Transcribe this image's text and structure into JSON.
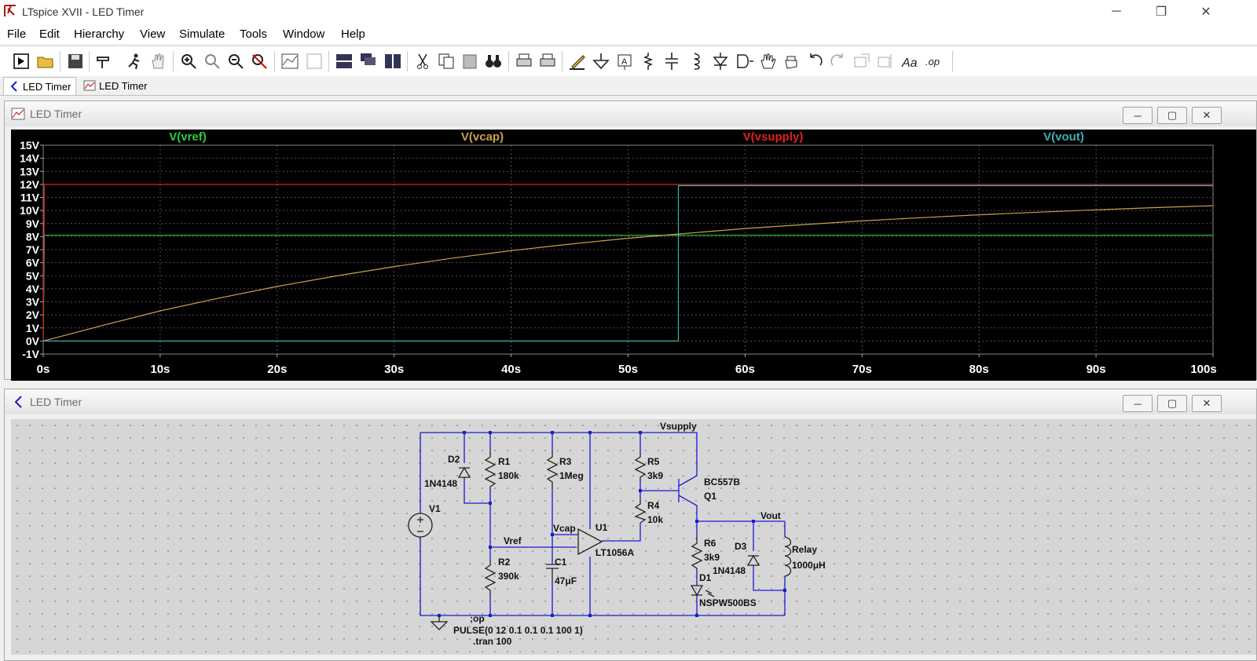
{
  "app": {
    "title": "LTspice XVII - LED Timer"
  },
  "menu": [
    "File",
    "Edit",
    "Hierarchy",
    "View",
    "Simulate",
    "Tools",
    "Window",
    "Help"
  ],
  "tabs": [
    {
      "label": "LED Timer"
    },
    {
      "label": "LED Timer"
    }
  ],
  "plot_window": {
    "title": "LED Timer"
  },
  "schematic_window": {
    "title": "LED Timer"
  },
  "colors": {
    "vref": "#2ecc40",
    "vcap": "#c8a050",
    "vsupply": "#e02020",
    "vout": "#40b0b0",
    "wire": "#1a1ad0",
    "grid": "#666666"
  },
  "chart_data": {
    "type": "line",
    "title": "",
    "xlabel": "",
    "ylabel": "",
    "xlim": [
      0,
      100
    ],
    "ylim": [
      -1,
      15
    ],
    "xticks": [
      "0s",
      "10s",
      "20s",
      "30s",
      "40s",
      "50s",
      "60s",
      "70s",
      "80s",
      "90s",
      "100s"
    ],
    "yticks": [
      "15V",
      "14V",
      "13V",
      "12V",
      "11V",
      "10V",
      "9V",
      "8V",
      "7V",
      "6V",
      "5V",
      "4V",
      "3V",
      "2V",
      "1V",
      "0V",
      "-1V"
    ],
    "grid": true,
    "series": [
      {
        "name": "V(vref)",
        "x": [
          0,
          0.1,
          100
        ],
        "values": [
          0,
          8.1,
          8.1
        ]
      },
      {
        "name": "V(vcap)",
        "x": [
          0,
          5,
          10,
          15,
          20,
          25,
          30,
          35,
          40,
          45,
          50,
          54.3,
          60,
          65,
          70,
          75,
          80,
          85,
          90,
          95,
          100
        ],
        "values": [
          0,
          1.18,
          2.31,
          3.28,
          4.18,
          4.98,
          5.7,
          6.35,
          6.92,
          7.42,
          7.87,
          8.2,
          8.62,
          8.92,
          9.2,
          9.45,
          9.67,
          9.87,
          10.05,
          10.22,
          10.37
        ]
      },
      {
        "name": "V(vsupply)",
        "x": [
          0,
          0.1,
          100
        ],
        "values": [
          0,
          12,
          12
        ]
      },
      {
        "name": "V(vout)",
        "x": [
          0,
          54.3,
          54.3,
          100
        ],
        "values": [
          0,
          0,
          11.9,
          11.9
        ]
      }
    ]
  },
  "schematic": {
    "labels": {
      "vsupply": "Vsupply",
      "vout": "Vout",
      "vref": "Vref",
      "vcap": "Vcap",
      "d2": "D2",
      "d2_val": "1N4148",
      "r1": "R1",
      "r1_val": "180k",
      "r3": "R3",
      "r3_val": "1Meg",
      "r5": "R5",
      "r5_val": "3k9",
      "q1_model": "BC557B",
      "q1": "Q1",
      "r4": "R4",
      "r4_val": "10k",
      "v1": "V1",
      "u1": "U1",
      "u1_model": "LT1056A",
      "r2": "R2",
      "r2_val": "390k",
      "c1": "C1",
      "c1_val": "47μF",
      "r6": "R6",
      "r6_val": "3k9",
      "d3": "D3",
      "d3_val": "1N4148",
      "relay": "Relay",
      "relay_val": "1000μH",
      "d1": "D1",
      "d1_model": "NSPW500BS",
      "op": ";op",
      "pulse": "PULSE(0 12 0.1 0.1 0.1 100 1)",
      "tran": ".tran 100"
    }
  }
}
